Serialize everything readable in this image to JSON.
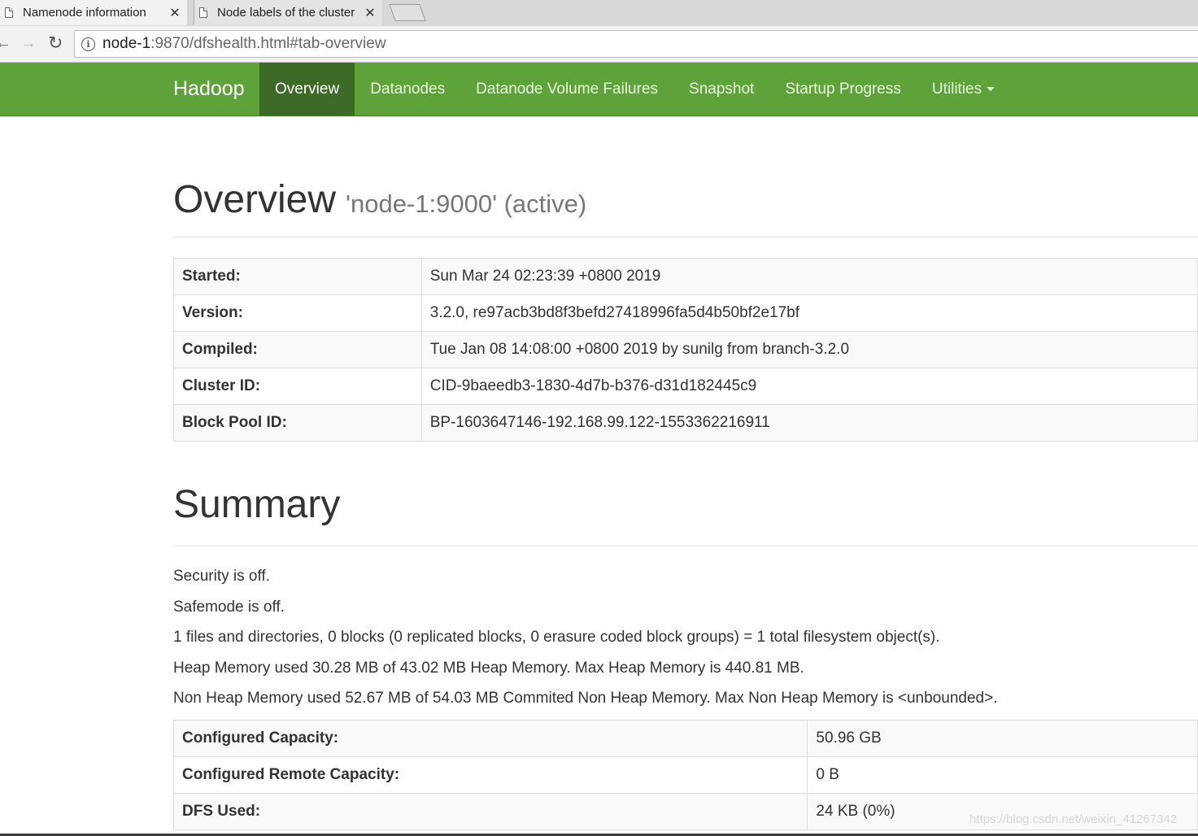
{
  "browser": {
    "tabs": [
      {
        "title": "Namenode information",
        "active": true
      },
      {
        "title": "Node labels of the cluster",
        "active": false
      }
    ],
    "url": {
      "host": "node-1",
      "rest": ":9870/dfshealth.html#tab-overview"
    }
  },
  "navbar": {
    "brand": "Hadoop",
    "items": [
      "Overview",
      "Datanodes",
      "Datanode Volume Failures",
      "Snapshot",
      "Startup Progress",
      "Utilities"
    ],
    "active": "Overview",
    "color": "#5ea33a"
  },
  "overview": {
    "title": "Overview",
    "subtitle": "'node-1:9000' (active)",
    "rows": [
      {
        "label": "Started:",
        "value": "Sun Mar 24 02:23:39 +0800 2019"
      },
      {
        "label": "Version:",
        "value": "3.2.0, re97acb3bd8f3befd27418996fa5d4b50bf2e17bf"
      },
      {
        "label": "Compiled:",
        "value": "Tue Jan 08 14:08:00 +0800 2019 by sunilg from branch-3.2.0"
      },
      {
        "label": "Cluster ID:",
        "value": "CID-9baeedb3-1830-4d7b-b376-d31d182445c9"
      },
      {
        "label": "Block Pool ID:",
        "value": "BP-1603647146-192.168.99.122-1553362216911"
      }
    ]
  },
  "summary": {
    "title": "Summary",
    "lines": [
      "Security is off.",
      "Safemode is off.",
      "1 files and directories, 0 blocks (0 replicated blocks, 0 erasure coded block groups) = 1 total filesystem object(s).",
      "Heap Memory used 30.28 MB of 43.02 MB Heap Memory. Max Heap Memory is 440.81 MB.",
      "Non Heap Memory used 52.67 MB of 54.03 MB Commited Non Heap Memory. Max Non Heap Memory is <unbounded>."
    ],
    "rows": [
      {
        "label": "Configured Capacity:",
        "value": "50.96 GB"
      },
      {
        "label": "Configured Remote Capacity:",
        "value": "0 B"
      },
      {
        "label": "DFS Used:",
        "value": "24 KB (0%)"
      }
    ]
  },
  "watermark": "https://blog.csdn.net/weixin_41267342"
}
